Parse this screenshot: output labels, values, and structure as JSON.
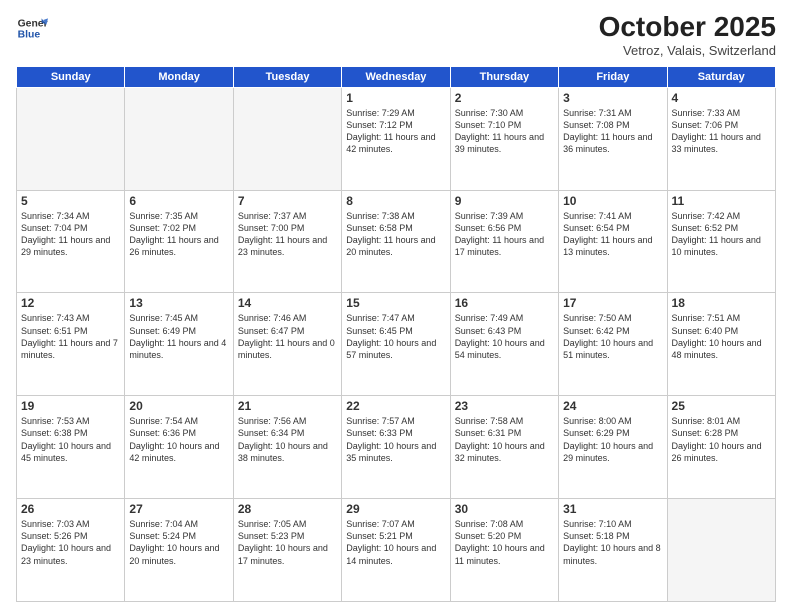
{
  "header": {
    "logo_line1": "General",
    "logo_line2": "Blue",
    "month_title": "October 2025",
    "location": "Vetroz, Valais, Switzerland"
  },
  "weekdays": [
    "Sunday",
    "Monday",
    "Tuesday",
    "Wednesday",
    "Thursday",
    "Friday",
    "Saturday"
  ],
  "weeks": [
    [
      {
        "day": "",
        "empty": true
      },
      {
        "day": "",
        "empty": true
      },
      {
        "day": "",
        "empty": true
      },
      {
        "day": "1",
        "sunrise": "7:29 AM",
        "sunset": "7:12 PM",
        "daylight": "11 hours and 42 minutes."
      },
      {
        "day": "2",
        "sunrise": "7:30 AM",
        "sunset": "7:10 PM",
        "daylight": "11 hours and 39 minutes."
      },
      {
        "day": "3",
        "sunrise": "7:31 AM",
        "sunset": "7:08 PM",
        "daylight": "11 hours and 36 minutes."
      },
      {
        "day": "4",
        "sunrise": "7:33 AM",
        "sunset": "7:06 PM",
        "daylight": "11 hours and 33 minutes."
      }
    ],
    [
      {
        "day": "5",
        "sunrise": "7:34 AM",
        "sunset": "7:04 PM",
        "daylight": "11 hours and 29 minutes."
      },
      {
        "day": "6",
        "sunrise": "7:35 AM",
        "sunset": "7:02 PM",
        "daylight": "11 hours and 26 minutes."
      },
      {
        "day": "7",
        "sunrise": "7:37 AM",
        "sunset": "7:00 PM",
        "daylight": "11 hours and 23 minutes."
      },
      {
        "day": "8",
        "sunrise": "7:38 AM",
        "sunset": "6:58 PM",
        "daylight": "11 hours and 20 minutes."
      },
      {
        "day": "9",
        "sunrise": "7:39 AM",
        "sunset": "6:56 PM",
        "daylight": "11 hours and 17 minutes."
      },
      {
        "day": "10",
        "sunrise": "7:41 AM",
        "sunset": "6:54 PM",
        "daylight": "11 hours and 13 minutes."
      },
      {
        "day": "11",
        "sunrise": "7:42 AM",
        "sunset": "6:52 PM",
        "daylight": "11 hours and 10 minutes."
      }
    ],
    [
      {
        "day": "12",
        "sunrise": "7:43 AM",
        "sunset": "6:51 PM",
        "daylight": "11 hours and 7 minutes."
      },
      {
        "day": "13",
        "sunrise": "7:45 AM",
        "sunset": "6:49 PM",
        "daylight": "11 hours and 4 minutes."
      },
      {
        "day": "14",
        "sunrise": "7:46 AM",
        "sunset": "6:47 PM",
        "daylight": "11 hours and 0 minutes."
      },
      {
        "day": "15",
        "sunrise": "7:47 AM",
        "sunset": "6:45 PM",
        "daylight": "10 hours and 57 minutes."
      },
      {
        "day": "16",
        "sunrise": "7:49 AM",
        "sunset": "6:43 PM",
        "daylight": "10 hours and 54 minutes."
      },
      {
        "day": "17",
        "sunrise": "7:50 AM",
        "sunset": "6:42 PM",
        "daylight": "10 hours and 51 minutes."
      },
      {
        "day": "18",
        "sunrise": "7:51 AM",
        "sunset": "6:40 PM",
        "daylight": "10 hours and 48 minutes."
      }
    ],
    [
      {
        "day": "19",
        "sunrise": "7:53 AM",
        "sunset": "6:38 PM",
        "daylight": "10 hours and 45 minutes."
      },
      {
        "day": "20",
        "sunrise": "7:54 AM",
        "sunset": "6:36 PM",
        "daylight": "10 hours and 42 minutes."
      },
      {
        "day": "21",
        "sunrise": "7:56 AM",
        "sunset": "6:34 PM",
        "daylight": "10 hours and 38 minutes."
      },
      {
        "day": "22",
        "sunrise": "7:57 AM",
        "sunset": "6:33 PM",
        "daylight": "10 hours and 35 minutes."
      },
      {
        "day": "23",
        "sunrise": "7:58 AM",
        "sunset": "6:31 PM",
        "daylight": "10 hours and 32 minutes."
      },
      {
        "day": "24",
        "sunrise": "8:00 AM",
        "sunset": "6:29 PM",
        "daylight": "10 hours and 29 minutes."
      },
      {
        "day": "25",
        "sunrise": "8:01 AM",
        "sunset": "6:28 PM",
        "daylight": "10 hours and 26 minutes."
      }
    ],
    [
      {
        "day": "26",
        "sunrise": "7:03 AM",
        "sunset": "5:26 PM",
        "daylight": "10 hours and 23 minutes."
      },
      {
        "day": "27",
        "sunrise": "7:04 AM",
        "sunset": "5:24 PM",
        "daylight": "10 hours and 20 minutes."
      },
      {
        "day": "28",
        "sunrise": "7:05 AM",
        "sunset": "5:23 PM",
        "daylight": "10 hours and 17 minutes."
      },
      {
        "day": "29",
        "sunrise": "7:07 AM",
        "sunset": "5:21 PM",
        "daylight": "10 hours and 14 minutes."
      },
      {
        "day": "30",
        "sunrise": "7:08 AM",
        "sunset": "5:20 PM",
        "daylight": "10 hours and 11 minutes."
      },
      {
        "day": "31",
        "sunrise": "7:10 AM",
        "sunset": "5:18 PM",
        "daylight": "10 hours and 8 minutes."
      },
      {
        "day": "",
        "empty": true
      }
    ]
  ]
}
